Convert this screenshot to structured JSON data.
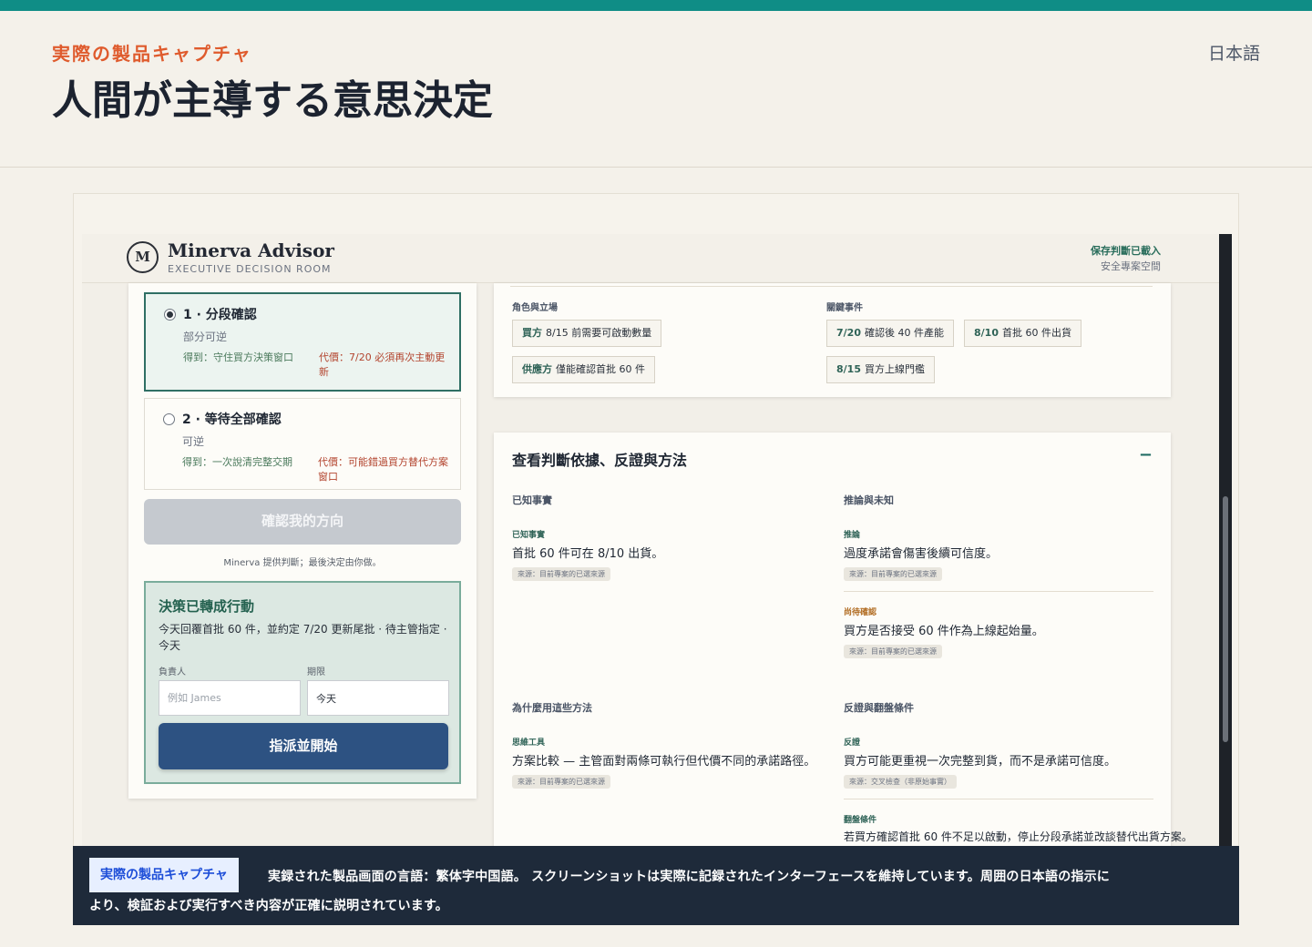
{
  "page": {
    "eyebrow": "実際の製品キャプチャ",
    "title": "人間が主導する意思決定",
    "language": "日本語"
  },
  "app": {
    "logo_letter": "M",
    "title": "Minerva Advisor",
    "subtitle": "EXECUTIVE DECISION ROOM",
    "save_status": "保存判斷已載入",
    "space_label": "安全專案空間"
  },
  "options": [
    {
      "title": "1 · 分段確認",
      "reversibility": "部分可逆",
      "gain": "得到：守住買方決策窗口",
      "cost": "代價：7/20 必須再次主動更新",
      "selected": true
    },
    {
      "title": "2 · 等待全部確認",
      "reversibility": "可逆",
      "gain": "得到：一次說清完整交期",
      "cost": "代價：可能錯過買方替代方案窗口",
      "selected": false
    }
  ],
  "confirm_button": "確認我的方向",
  "minerva_note": "Minerva 提供判斷；最後決定由你做。",
  "action": {
    "title": "決策已轉成行動",
    "description": "今天回覆首批 60 件，並約定 7/20 更新尾批 · 待主管指定 · 今天",
    "owner_label": "負責人",
    "owner_placeholder": "例如 James",
    "deadline_label": "期限",
    "deadline_value": "今天",
    "assign_button": "指派並開始"
  },
  "context": {
    "roles_label": "角色與立場",
    "events_label": "關鍵事件",
    "roles": [
      {
        "key": "買方",
        "text": "8/15 前需要可啟動數量"
      },
      {
        "key": "供應方",
        "text": "僅能確認首批 60 件"
      }
    ],
    "events": [
      {
        "key": "7/20",
        "text": "確認後 40 件產能"
      },
      {
        "key": "8/10",
        "text": "首批 60 件出貨"
      },
      {
        "key": "8/15",
        "text": "買方上線門檻"
      }
    ]
  },
  "evidence": {
    "title": "查看判斷依據、反證與方法",
    "collapse_symbol": "−",
    "known_facts_head": "已知事實",
    "inference_head": "推論與未知",
    "method_head": "為什麼用這些方法",
    "counter_head": "反證與翻盤條件",
    "fact": {
      "tag": "已知事實",
      "text": "首批 60 件可在 8/10 出貨。",
      "source": "來源：目前專案的已選來源"
    },
    "inference": {
      "tag": "推論",
      "text": "過度承諾會傷害後續可信度。",
      "source": "來源：目前專案的已選來源"
    },
    "pending": {
      "tag": "尚待確認",
      "text": "買方是否接受 60 件作為上線起始量。",
      "source": "來源：目前專案的已選來源"
    },
    "method": {
      "tag": "思維工具",
      "text": "方案比較 — 主管面對兩條可執行但代價不同的承諾路徑。",
      "source": "來源：目前專案的已選來源"
    },
    "counter": {
      "tag": "反證",
      "text": "買方可能更重視一次完整到貨，而不是承諾可信度。",
      "source": "來源：交叉檢查（非原始事實）"
    },
    "flip": {
      "tag": "翻盤條件",
      "text": "若買方確認首批 60 件不足以啟動，停止分段承諾並改談替代出貨方案。"
    }
  },
  "caption": {
    "badge": "実際の製品キャプチャ",
    "line1": "実録された製品画面の言語：繁体字中国語。 スクリーンショットは実際に記録されたインターフェースを維持しています。周囲の日本語の指示に",
    "line2": "より、検証および実行すべき内容が正確に説明されています。"
  },
  "colors": {
    "accent_teal": "#0f8d86",
    "eyebrow_orange": "#df5b2d",
    "primary_navy": "#2d5282",
    "caption_bg": "#1e2a3a"
  }
}
